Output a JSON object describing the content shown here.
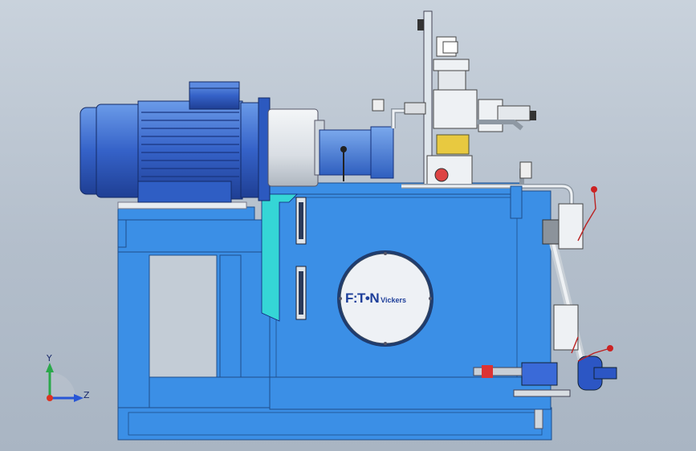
{
  "viewport": {
    "background_top": "#c9d2dc",
    "background_bottom": "#a9b5c3"
  },
  "colors": {
    "frame_blue": "#3b8fe6",
    "frame_edge": "#1f4e8a",
    "motor_blue": "#3d72d6",
    "cyan_plate": "#35d6d6",
    "valve_white": "#eef1f4",
    "pipe_gray": "#c8cfd6"
  },
  "logo": {
    "brand": "F:T•N",
    "sub": "Vickers"
  },
  "triad": {
    "y_label": "Y",
    "z_label": "Z",
    "icon": "coordinate-triad-icon"
  }
}
